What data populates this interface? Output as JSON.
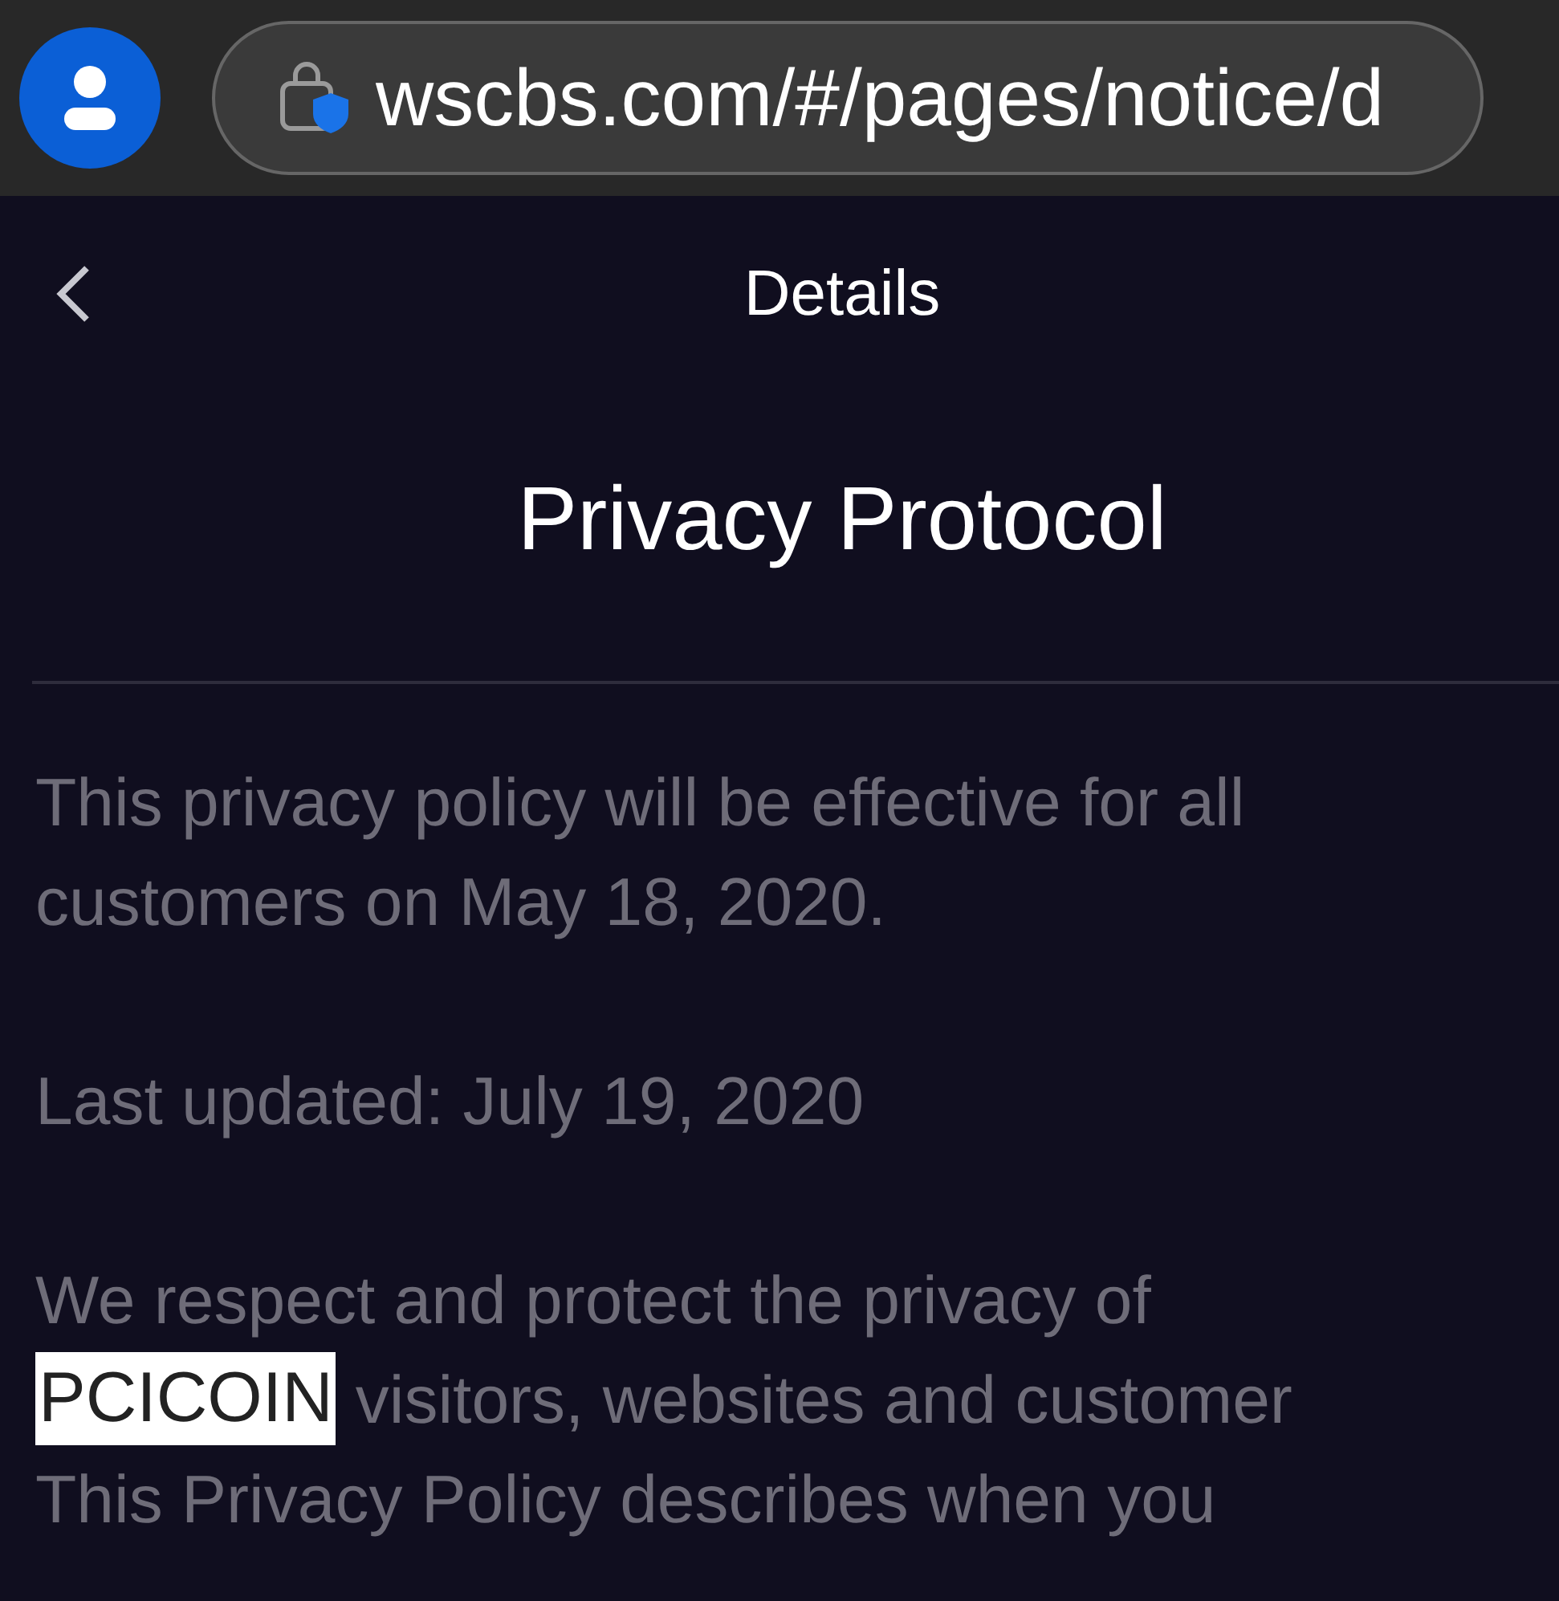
{
  "browser": {
    "url": "wscbs.com/#/pages/notice/d"
  },
  "header": {
    "title": "Details"
  },
  "article": {
    "title": "Privacy Protocol",
    "paragraphs": [
      {
        "lines": [
          {
            "parts": [
              {
                "text": "This privacy policy will be effective for all",
                "highlighted": false
              }
            ]
          },
          {
            "parts": [
              {
                "text": "customers on May 18, 2020.",
                "highlighted": false
              }
            ]
          }
        ]
      },
      {
        "lines": [
          {
            "parts": [
              {
                "text": "Last updated: July 19, 2020",
                "highlighted": false
              }
            ]
          }
        ]
      },
      {
        "lines": [
          {
            "parts": [
              {
                "text": "We respect and protect the privacy of",
                "highlighted": false
              }
            ]
          },
          {
            "parts": [
              {
                "text": "PCICOIN",
                "highlighted": true
              },
              {
                "text": "visitors, websites and customer",
                "highlighted": false
              }
            ]
          },
          {
            "parts": [
              {
                "text": "This Privacy Policy describes when you",
                "highlighted": false
              }
            ]
          }
        ]
      }
    ]
  }
}
